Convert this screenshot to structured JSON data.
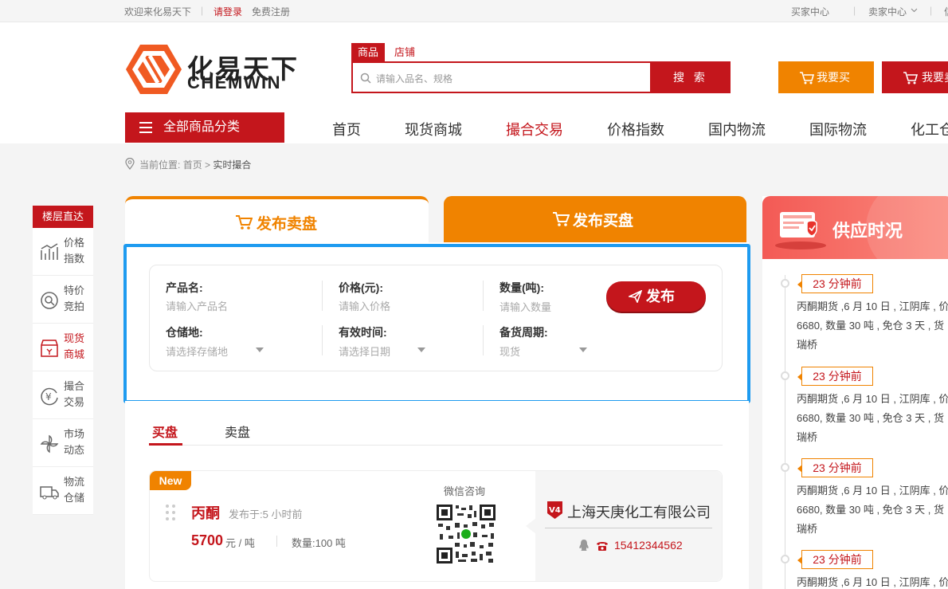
{
  "topbar": {
    "welcome": "欢迎来化易天下",
    "login": "请登录",
    "register": "免费注册",
    "buyer_center": "买家中心",
    "seller_center": "卖家中心",
    "more": "信"
  },
  "logo": {
    "cn": "化易天下",
    "en": "CHEMWIN"
  },
  "search": {
    "tab_goods": "商品",
    "tab_shop": "店铺",
    "placeholder": "请输入品名、规格",
    "button": "搜 索"
  },
  "header_buttons": {
    "buy": "我要买",
    "sell": "我要卖"
  },
  "nav": {
    "all_categories": "全部商品分类",
    "items": [
      "首页",
      "现货商城",
      "撮合交易",
      "价格指数",
      "国内物流",
      "国际物流",
      "化工仓"
    ],
    "active_index": 2
  },
  "breadcrumb": {
    "prefix": "当前位置:",
    "home": "首页",
    "sep": ">",
    "current": "实时撮合"
  },
  "floor_nav": {
    "title": "楼层直达",
    "items": [
      {
        "label": "价格指数",
        "icon": "chart-icon"
      },
      {
        "label": "特价竞拍",
        "icon": "auction-icon"
      },
      {
        "label": "现货商城",
        "icon": "shop-icon"
      },
      {
        "label": "撮合交易",
        "icon": "yen-exchange-icon"
      },
      {
        "label": "市场动态",
        "icon": "pinwheel-icon"
      },
      {
        "label": "物流仓储",
        "icon": "truck-icon"
      }
    ],
    "selected_index": 2
  },
  "publish_tabs": {
    "sell": "发布卖盘",
    "buy": "发布买盘"
  },
  "form": {
    "product_label": "产品名:",
    "product_placeholder": "请输入产品名",
    "price_label": "价格(元):",
    "price_placeholder": "请输入价格",
    "qty_label": "数量(吨):",
    "qty_placeholder": "请输入数量",
    "storage_label": "仓储地:",
    "storage_placeholder": "请选择存储地",
    "valid_label": "有效时间:",
    "valid_placeholder": "请选择日期",
    "period_label": "备货周期:",
    "period_value": "现货",
    "publish_button": "发布"
  },
  "list_tabs": {
    "buy": "买盘",
    "sell": "卖盘"
  },
  "listing": {
    "tag": "New",
    "product": "丙酮",
    "published": "发布于:5 小时前",
    "price": "5700",
    "price_unit": "元 / 吨",
    "quantity": "数量:100 吨",
    "wechat": "微信咨询",
    "company": "上海天庚化工有限公司",
    "vip": "V4",
    "phone": "15412344562"
  },
  "supply": {
    "title": "供应时况",
    "entries": [
      {
        "ago": "23 分钟前",
        "line1": "丙酮期货 ,6 月 10 日 , 江阴库 , 价",
        "line2": "6680, 数量 30 吨 , 免仓 3 天 , 货",
        "line3": "瑞桥"
      },
      {
        "ago": "23 分钟前",
        "line1": "丙酮期货 ,6 月 10 日 , 江阴库 , 价",
        "line2": "6680, 数量 30 吨 , 免仓 3 天 , 货",
        "line3": "瑞桥"
      },
      {
        "ago": "23 分钟前",
        "line1": "丙酮期货 ,6 月 10 日 , 江阴库 , 价",
        "line2": "6680, 数量 30 吨 , 免仓 3 天 , 货",
        "line3": "瑞桥"
      },
      {
        "ago": "23 分钟前",
        "line1": "丙酮期货 ,6 月 10 日 , 江阴库 , 价",
        "line2": "",
        "line3": ""
      }
    ]
  },
  "colors": {
    "brand_red": "#c4161c",
    "orange": "#f08300",
    "highlight": "#1e9bf0"
  }
}
